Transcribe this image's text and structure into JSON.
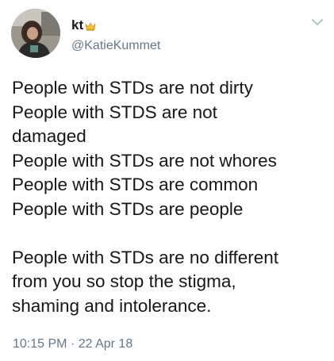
{
  "author": {
    "display_name": "kt",
    "handle": "@KatieKummet",
    "name_emoji_icon": "crown-icon",
    "avatar_icon": "profile-photo"
  },
  "menu": {
    "icon": "chevron-down-icon"
  },
  "tweet": {
    "lines": [
      "People with STDs are not dirty",
      "People with STDS are not",
      "damaged",
      "People with STDs are not whores",
      "People with STDs are common",
      "People with STDs are people",
      "",
      "People with STDs are no different",
      "from you so stop the stigma,",
      "shaming and intolerance."
    ],
    "time": "10:15 PM",
    "separator": "·",
    "date": "22 Apr 18"
  },
  "colors": {
    "text": "#14171a",
    "secondary": "#657786",
    "crown": "#f5c242"
  }
}
